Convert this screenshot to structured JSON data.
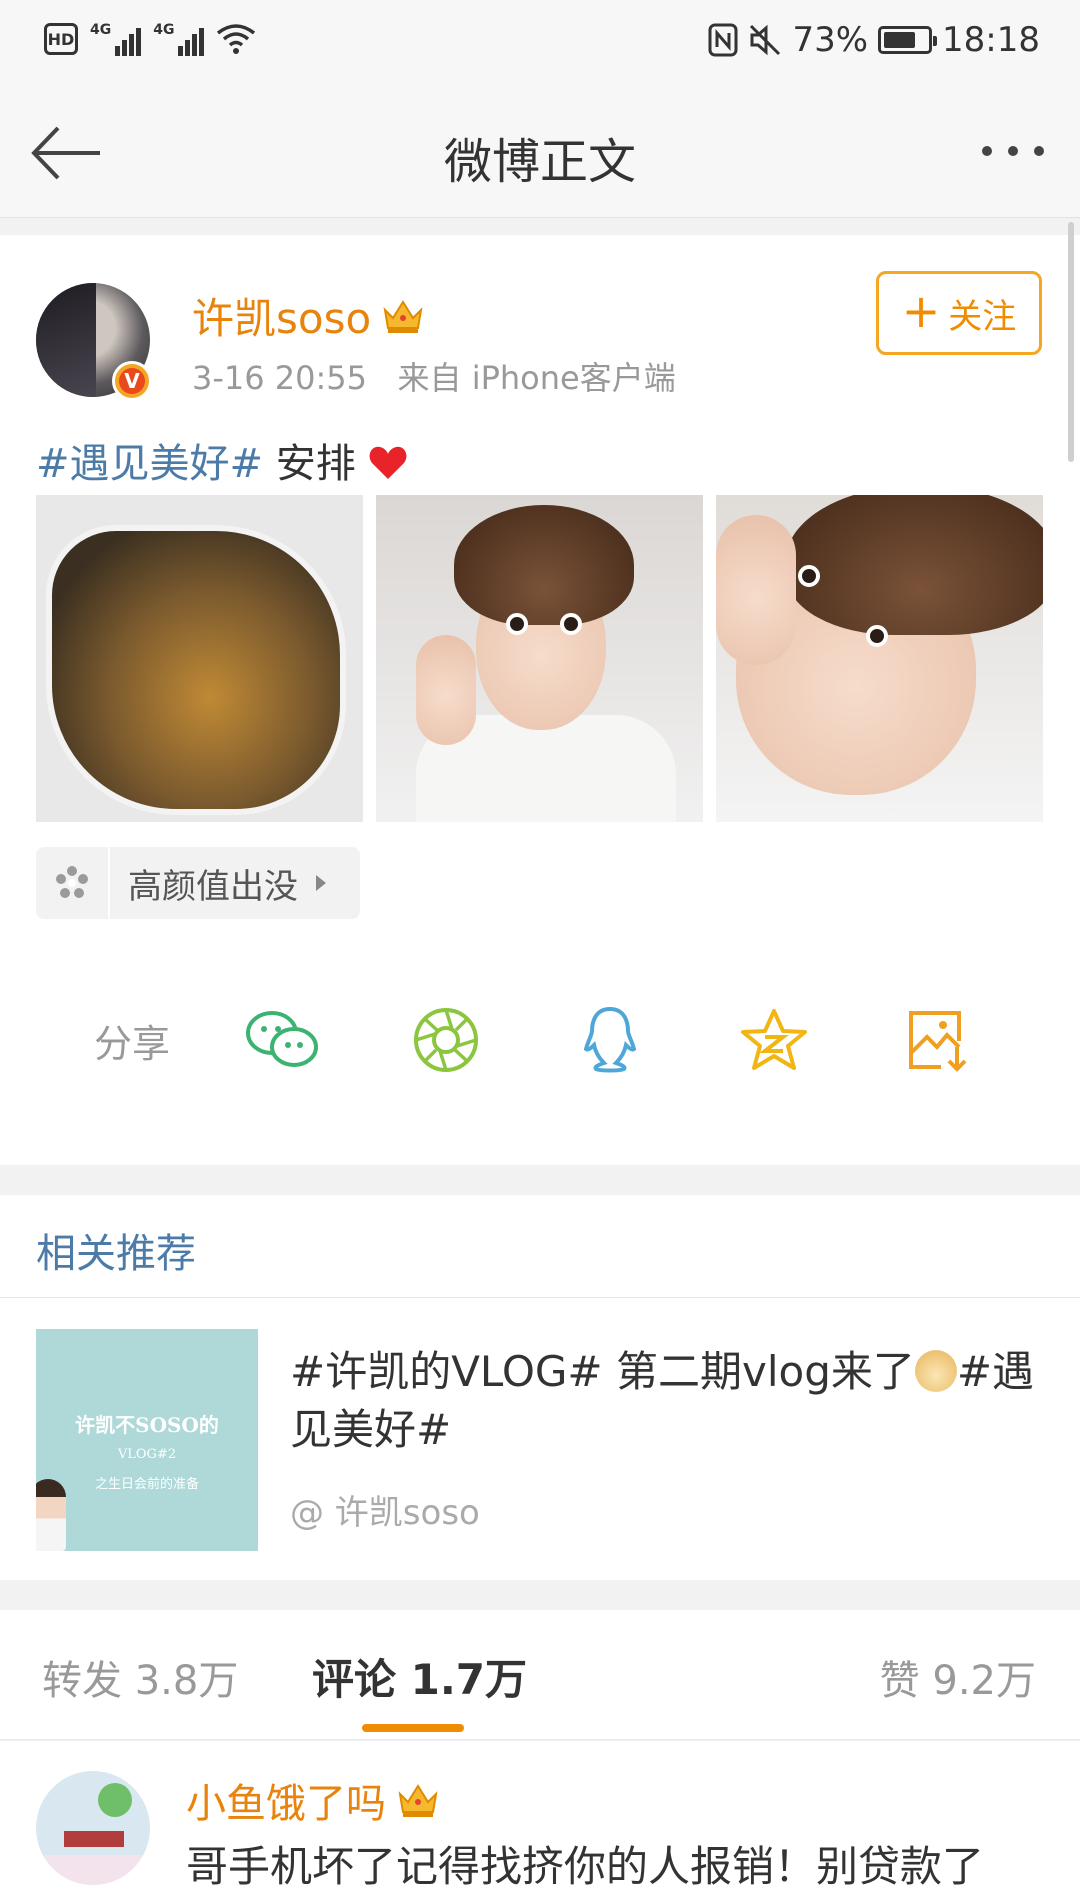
{
  "status_bar": {
    "hd": "HD",
    "network1": "4G",
    "network2": "4G",
    "battery": "73%",
    "battery_level": 0.73,
    "time": "18:18"
  },
  "nav": {
    "title": "微博正文"
  },
  "post": {
    "author": "许凯soso",
    "time": "3-16 20:55",
    "source": "来自 iPhone客户端",
    "follow_label": "关注",
    "topic_tag": "#遇见美好#",
    "text": " 安排",
    "chip_label": "高颜值出没",
    "share_label": "分享",
    "share_targets": [
      "wechat-icon",
      "moments-icon",
      "qq-icon",
      "qzone-icon",
      "save-image-icon"
    ]
  },
  "related": {
    "heading": "相关推荐",
    "title_part1": "#许凯的VLOG# 第二期vlog来了",
    "title_part2": "#遇见美好#",
    "author": "@ 许凯soso",
    "thumb_line1": "许凯不SOSO的",
    "thumb_line2": "VLOG#2",
    "thumb_line3": "之生日会前的准备"
  },
  "tabs": {
    "repost": "转发 3.8万",
    "comment": "评论 1.7万",
    "like": "赞 9.2万"
  },
  "comment": {
    "author": "小鱼饿了吗",
    "text": "哥手机坏了记得找挤你的人报销！别贷款了"
  },
  "colors": {
    "accent_orange": "#f08c00",
    "username": "#e8830c",
    "link_blue": "#4c7ba8"
  }
}
